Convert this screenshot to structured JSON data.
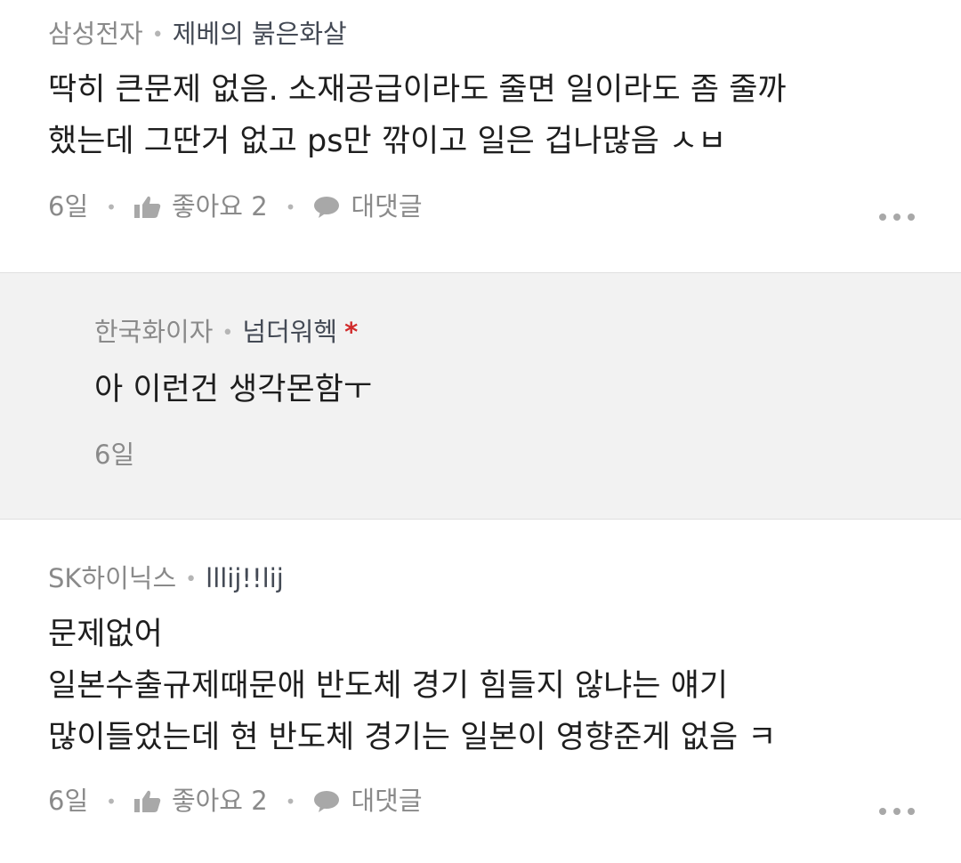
{
  "comments": [
    {
      "company": "삼성전자",
      "nickname": "제베의 붉은화살",
      "lines": [
        "딱히 큰문제 없음. 소재공급이라도 줄면 일이라도 좀 줄까",
        "했는데 그딴거 없고 ps만 깎이고 일은 겁나많음 ㅅㅂ"
      ],
      "time": "6일",
      "like_label": "좋아요",
      "like_count": "2",
      "reply_label": "대댓글"
    },
    {
      "company": "한국화이자",
      "nickname": "넘더워헥",
      "author_mark": "*",
      "lines": [
        "아 이런건 생각몬함ㅜ"
      ],
      "time": "6일"
    },
    {
      "company": "SK하이닉스",
      "nickname": "lllij!!lij",
      "lines": [
        "문제없어",
        "일본수출규제때문애 반도체 경기 힘들지 않냐는 얘기",
        "많이들었는데 현 반도체 경기는 일본이 영향준게 없음 ㅋ"
      ],
      "time": "6일",
      "like_label": "좋아요",
      "like_count": "2",
      "reply_label": "대댓글"
    }
  ],
  "icons": {
    "like": "thumbs-up-icon",
    "reply": "speech-bubble-icon",
    "more": "more-horizontal-icon"
  },
  "colors": {
    "reply_background": "#f2f2f2",
    "author_mark": "#d12b2b",
    "meta_text": "#8a8a8a",
    "nickname_text": "#444a55"
  }
}
